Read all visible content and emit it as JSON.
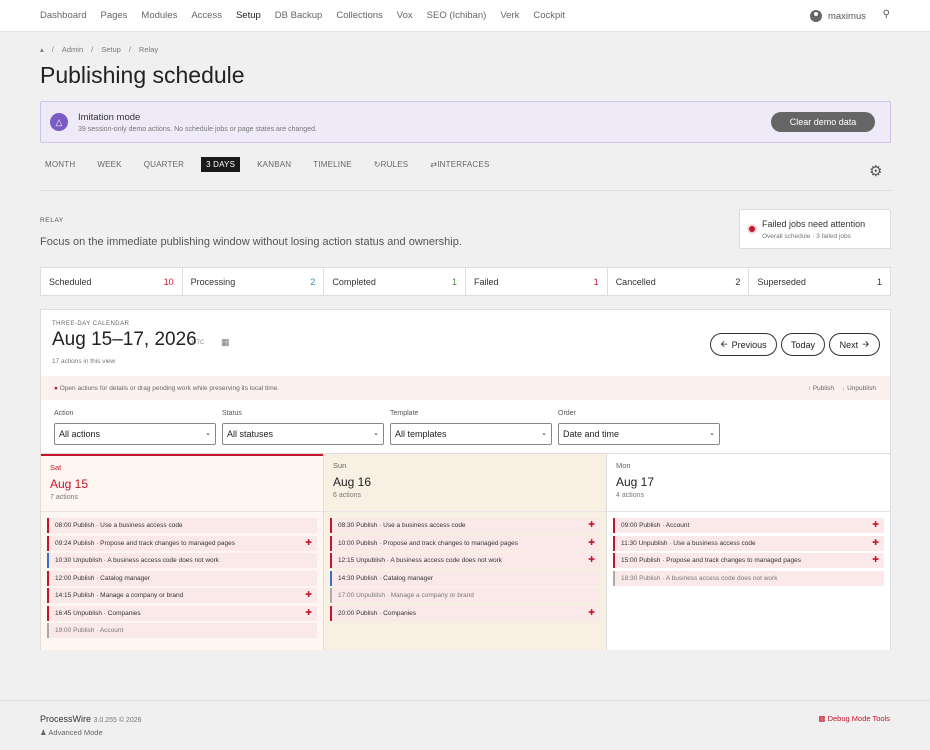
{
  "nav": {
    "items": [
      "Dashboard",
      "Pages",
      "Modules",
      "Access",
      "Setup",
      "DB Backup",
      "Collections",
      "Vox",
      "SEO (Ichiban)",
      "Verk",
      "Cockpit"
    ],
    "user": "maximus"
  },
  "breadcrumb": [
    "Admin",
    "Setup",
    "Relay"
  ],
  "title": "Publishing schedule",
  "imitation": {
    "title": "Imitation mode",
    "desc": "39 session-only demo actions. No schedule jobs or page states are changed.",
    "button": "Clear demo data"
  },
  "views": [
    "MONTH",
    "WEEK",
    "QUARTER",
    "3 DAYS",
    "KANBAN",
    "TIMELINE",
    "RULES",
    "INTERFACES"
  ],
  "active_view": "3 DAYS",
  "section": {
    "kicker": "RELAY",
    "lead": "Focus on the immediate publishing window without losing action status and ownership."
  },
  "alert": {
    "title": "Failed jobs need attention",
    "sub": "Overall schedule · 3 failed jobs"
  },
  "stats": [
    {
      "label": "Scheduled",
      "value": "10",
      "color": "#c4162a"
    },
    {
      "label": "Processing",
      "value": "2",
      "color": "#2a8fc4"
    },
    {
      "label": "Completed",
      "value": "1",
      "color": "#3a8f3a"
    },
    {
      "label": "Failed",
      "value": "1",
      "color": "#c4162a"
    },
    {
      "label": "Cancelled",
      "value": "2",
      "color": "#333333"
    },
    {
      "label": "Superseded",
      "value": "1",
      "color": "#333333"
    }
  ],
  "calendar": {
    "kicker": "THREE-DAY CALENDAR",
    "title": "Aug 15–17, 2026",
    "tz": "UTC",
    "count": "17 actions in this view",
    "prev": "Previous",
    "today": "Today",
    "next": "Next",
    "hint": "Open actions for details or drag pending work while preserving its local time.",
    "legend_publish": "Publish",
    "legend_unpublish": "Unpublish",
    "filters": [
      {
        "label": "Action",
        "value": "All actions"
      },
      {
        "label": "Status",
        "value": "All statuses"
      },
      {
        "label": "Template",
        "value": "All templates"
      },
      {
        "label": "Order",
        "value": "Date and time"
      }
    ],
    "days": [
      {
        "dow": "Sat",
        "date": "Aug 15",
        "count": "7 actions",
        "items": [
          {
            "text": "08:00 Publish · Use a business access code",
            "kind": "red",
            "plus": false
          },
          {
            "text": "09:24 Publish · Propose and track changes to managed pages",
            "kind": "red",
            "plus": true
          },
          {
            "text": "10:30 Unpublish · A business access code does not work",
            "kind": "blue",
            "plus": false
          },
          {
            "text": "12:00 Publish · Catalog manager",
            "kind": "red",
            "plus": false
          },
          {
            "text": "14:15 Publish · Manage a company or brand",
            "kind": "red",
            "plus": true
          },
          {
            "text": "16:45 Unpublish · Companies",
            "kind": "red",
            "plus": true
          },
          {
            "text": "19:00 Publish · Account",
            "kind": "grey",
            "plus": false
          }
        ]
      },
      {
        "dow": "Sun",
        "date": "Aug 16",
        "count": "6 actions",
        "items": [
          {
            "text": "08:30 Publish · Use a business access code",
            "kind": "red",
            "plus": true
          },
          {
            "text": "10:00 Publish · Propose and track changes to managed pages",
            "kind": "red",
            "plus": true
          },
          {
            "text": "12:15 Unpublish · A business access code does not work",
            "kind": "red",
            "plus": true
          },
          {
            "text": "14:30 Publish · Catalog manager",
            "kind": "blue",
            "plus": false
          },
          {
            "text": "17:00 Unpublish · Manage a company or brand",
            "kind": "grey",
            "plus": false
          },
          {
            "text": "20:00 Publish · Companies",
            "kind": "red",
            "plus": true
          }
        ]
      },
      {
        "dow": "Mon",
        "date": "Aug 17",
        "count": "4 actions",
        "items": [
          {
            "text": "09:00 Publish · Account",
            "kind": "red",
            "plus": true
          },
          {
            "text": "11:30 Unpublish · Use a business access code",
            "kind": "red",
            "plus": true
          },
          {
            "text": "15:00 Publish · Propose and track changes to managed pages",
            "kind": "red",
            "plus": true
          },
          {
            "text": "18:30 Publish · A business access code does not work",
            "kind": "grey",
            "plus": false
          }
        ]
      }
    ]
  },
  "footer": {
    "brand": "ProcessWire",
    "version": "3.0.255 © 2026",
    "mode": "Advanced Mode",
    "debug": "Debug Mode Tools"
  }
}
